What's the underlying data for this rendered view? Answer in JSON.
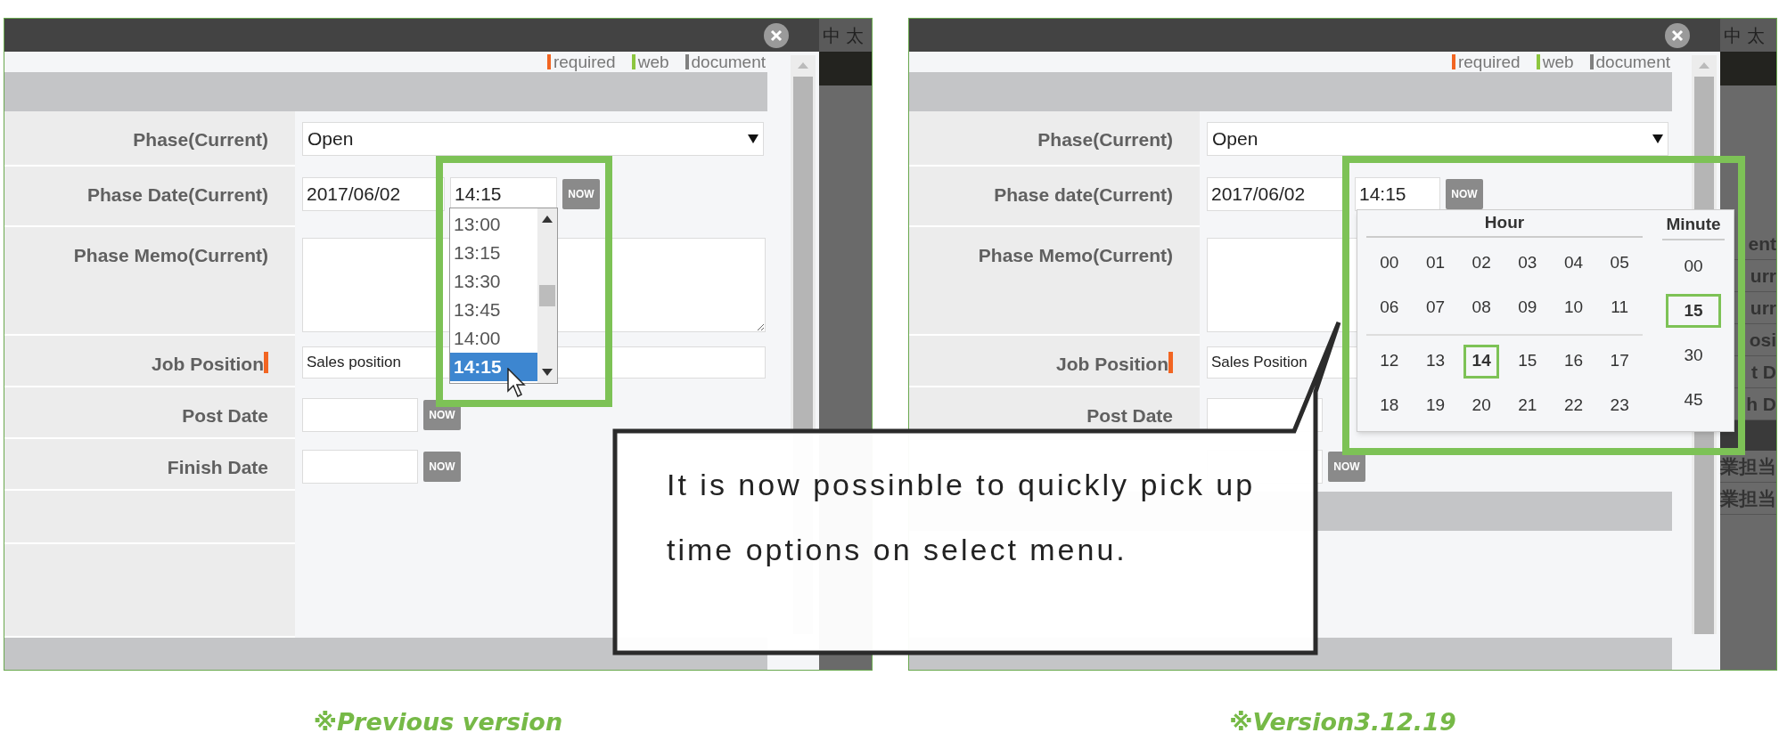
{
  "panels": [
    {
      "legend": [
        {
          "label": "required",
          "color": "#f26522"
        },
        {
          "label": "web",
          "color": "#8dc63f"
        },
        {
          "label": "document",
          "color": "#808080"
        }
      ],
      "fields": [
        {
          "kind": "select",
          "label": "Phase(Current)",
          "value": "Open"
        },
        {
          "kind": "datetime",
          "label": "Phase Date(Current)",
          "date": "2017/06/02",
          "time": "14:15",
          "button": "NOW"
        },
        {
          "kind": "textarea",
          "label": "Phase Memo(Current)"
        },
        {
          "kind": "text",
          "label": "Job Position",
          "required": true,
          "value": "Sales position"
        },
        {
          "kind": "date",
          "label": "Post Date",
          "button": "NOW"
        },
        {
          "kind": "date",
          "label": "Finish Date",
          "button": "NOW"
        },
        {
          "kind": "empty"
        },
        {
          "kind": "empty"
        }
      ],
      "time_list": {
        "items": [
          {
            "label": "13:00",
            "selected": false
          },
          {
            "label": "13:15",
            "selected": false
          },
          {
            "label": "13:30",
            "selected": false
          },
          {
            "label": "13:45",
            "selected": false
          },
          {
            "label": "14:00",
            "selected": false
          },
          {
            "label": "14:15",
            "selected": true
          }
        ]
      },
      "side_strip": {
        "header": "中 太"
      },
      "caption": "※Previous version"
    },
    {
      "legend": [
        {
          "label": "required",
          "color": "#f26522"
        },
        {
          "label": "web",
          "color": "#8dc63f"
        },
        {
          "label": "document",
          "color": "#808080"
        }
      ],
      "fields": [
        {
          "kind": "select",
          "label": "Phase(Current)",
          "value": "Open"
        },
        {
          "kind": "datetime",
          "label": "Phase date(Current)",
          "date": "2017/06/02",
          "time": "14:15",
          "button": "NOW"
        },
        {
          "kind": "textarea",
          "label": "Phase Memo(Current)"
        },
        {
          "kind": "text",
          "label": "Job Position",
          "required": true,
          "value": "Sales Position"
        },
        {
          "kind": "date",
          "label": "Post Date"
        },
        {
          "kind": "date",
          "button": "NOW"
        },
        {
          "kind": "section"
        },
        {
          "kind": "empty"
        },
        {
          "kind": "empty"
        }
      ],
      "time_picker": {
        "hour_title": "Hour",
        "minute_title": "Minute",
        "hours": [
          {
            "label": "00",
            "selected": false
          },
          {
            "label": "01",
            "selected": false
          },
          {
            "label": "02",
            "selected": false
          },
          {
            "label": "03",
            "selected": false
          },
          {
            "label": "04",
            "selected": false
          },
          {
            "label": "05",
            "selected": false
          },
          {
            "label": "06",
            "selected": false
          },
          {
            "label": "07",
            "selected": false
          },
          {
            "label": "08",
            "selected": false
          },
          {
            "label": "09",
            "selected": false
          },
          {
            "label": "10",
            "selected": false
          },
          {
            "label": "11",
            "selected": false
          },
          {
            "label": "12",
            "selected": false
          },
          {
            "label": "13",
            "selected": false
          },
          {
            "label": "14",
            "selected": true
          },
          {
            "label": "15",
            "selected": false
          },
          {
            "label": "16",
            "selected": false
          },
          {
            "label": "17",
            "selected": false
          },
          {
            "label": "18",
            "selected": false
          },
          {
            "label": "19",
            "selected": false
          },
          {
            "label": "20",
            "selected": false
          },
          {
            "label": "21",
            "selected": false
          },
          {
            "label": "22",
            "selected": false
          },
          {
            "label": "23",
            "selected": false
          }
        ],
        "minutes": [
          {
            "label": "00",
            "selected": false
          },
          {
            "label": "15",
            "selected": true
          },
          {
            "label": "30",
            "selected": false
          },
          {
            "label": "45",
            "selected": false
          }
        ]
      },
      "side_strip": {
        "header": "中 太",
        "items": [
          "ent",
          "urr",
          "urr",
          "osi",
          "t D",
          "h D",
          "業担当",
          "業担当"
        ]
      },
      "caption": "※Version3.12.19"
    }
  ],
  "callout": {
    "text": "It is now possinble to quickly pick up time options on select menu."
  }
}
